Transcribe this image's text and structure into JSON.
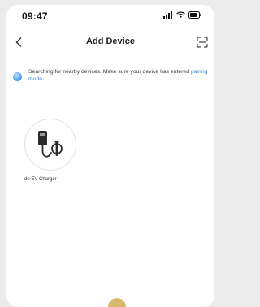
{
  "status_bar": {
    "time": "09:47"
  },
  "nav": {
    "title": "Add Device"
  },
  "banner": {
    "text": "Searching for nearby devices. Make sure your device has entered ",
    "link": "pairing mode",
    "suffix": "."
  },
  "devices": [
    {
      "name": "de EV Charger"
    }
  ]
}
